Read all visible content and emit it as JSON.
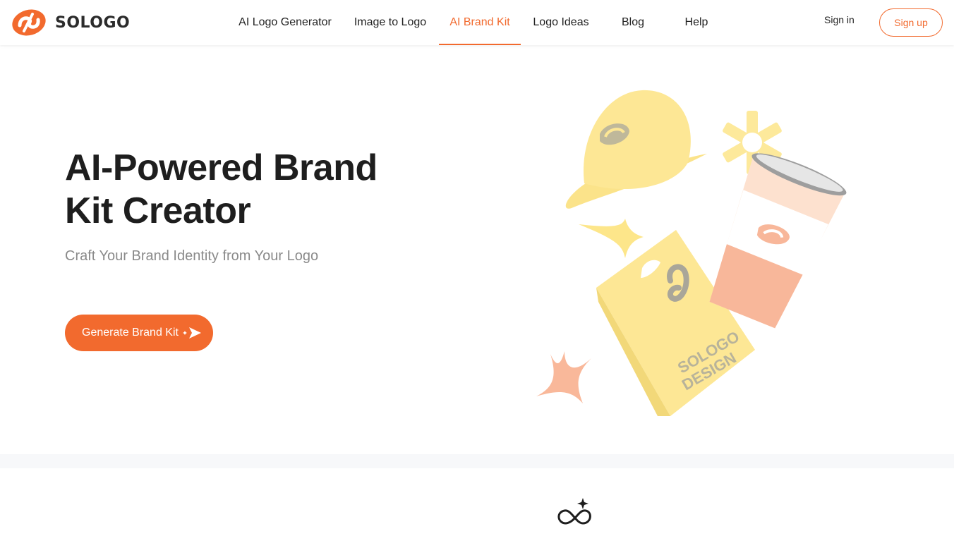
{
  "brand": {
    "name": "SOLOGO",
    "color": "#f26a2e"
  },
  "nav": {
    "items": [
      {
        "label": "AI Logo Generator",
        "active": false
      },
      {
        "label": "Image to Logo",
        "active": false
      },
      {
        "label": "AI Brand Kit",
        "active": true
      },
      {
        "label": "Logo Ideas",
        "active": false
      },
      {
        "label": "Blog",
        "active": false
      },
      {
        "label": "Help",
        "active": false
      }
    ],
    "signin_label": "Sign in",
    "signup_label": "Sign up"
  },
  "hero": {
    "title_line1": "AI-Powered Brand",
    "title_line2": "Kit Creator",
    "subtitle": "Craft Your Brand Identity from Your Logo",
    "cta_label": "Generate Brand Kit",
    "cta_icon": "send-sparkle-icon"
  },
  "illustration": {
    "bag_text_line1": "SOLOGO",
    "bag_text_line2": "DESIGN",
    "items": [
      "cap-icon",
      "coffee-cup-icon",
      "shopping-bag-icon",
      "sparkle-star-icon",
      "asterisk-icon"
    ]
  },
  "feature": {
    "icon": "infinity-sparkle-icon"
  }
}
